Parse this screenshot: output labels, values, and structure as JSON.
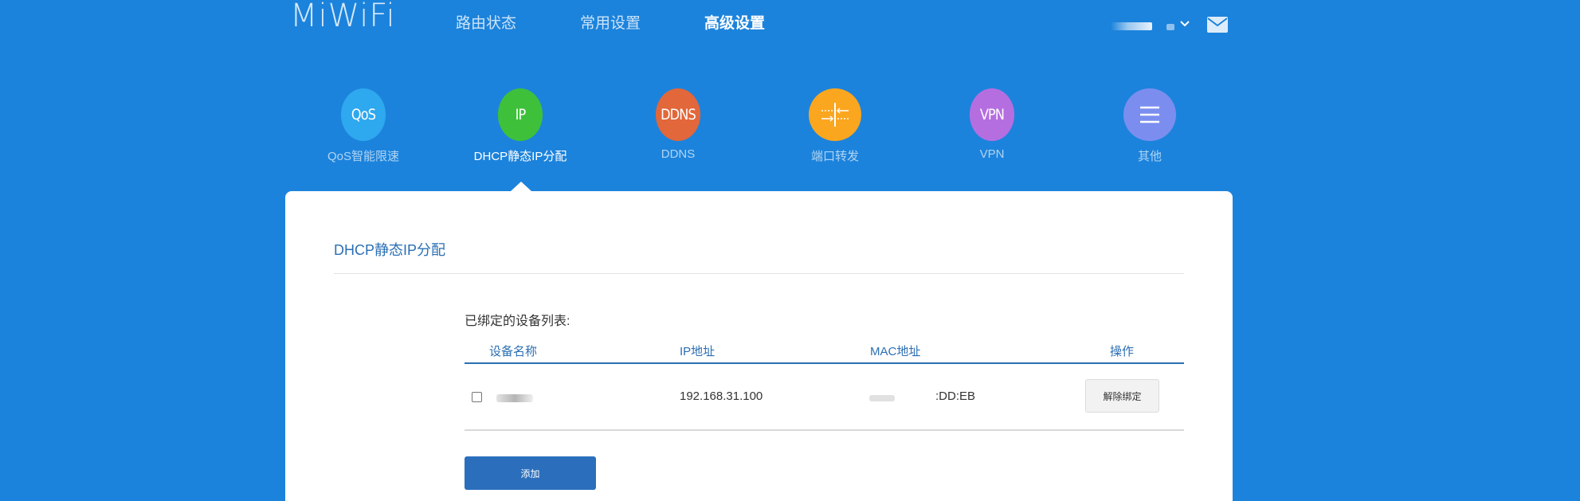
{
  "header": {
    "logo": "MiWiFi",
    "nav": [
      {
        "label": "路由状态",
        "active": false
      },
      {
        "label": "常用设置",
        "active": false
      },
      {
        "label": "高级设置",
        "active": true
      }
    ],
    "icons": {
      "user_menu": "chevron-down-icon",
      "messages": "mail-icon"
    }
  },
  "features": [
    {
      "icon_text": "QoS",
      "label": "QoS智能限速",
      "color": "#2ea8ef",
      "active": false
    },
    {
      "icon_text": "IP",
      "label": "DHCP静态IP分配",
      "color": "#3fc03b",
      "active": true
    },
    {
      "icon_text": "DDNS",
      "label": "DDNS",
      "color": "#e2673a",
      "active": false
    },
    {
      "icon_text": "",
      "label": "端口转发",
      "color": "#fba61f",
      "icon": "port-forward-icon",
      "active": false
    },
    {
      "icon_text": "VPN",
      "label": "VPN",
      "color": "#b56ee0",
      "active": false
    },
    {
      "icon_text": "",
      "label": "其他",
      "color": "#7b8ef0",
      "icon": "menu-lines-icon",
      "active": false
    }
  ],
  "panel": {
    "title": "DHCP静态IP分配",
    "list_label": "已绑定的设备列表:",
    "columns": [
      "设备名称",
      "IP地址",
      "MAC地址",
      "操作"
    ],
    "rows": [
      {
        "name": "",
        "ip": "192.168.31.100",
        "mac": ":DD:EB",
        "action": "解除绑定",
        "checked": false
      }
    ],
    "add_button": "添加"
  },
  "colors": {
    "background": "#1c83dc",
    "accent": "#2b6fb3",
    "button_primary": "#2b6fbc"
  }
}
